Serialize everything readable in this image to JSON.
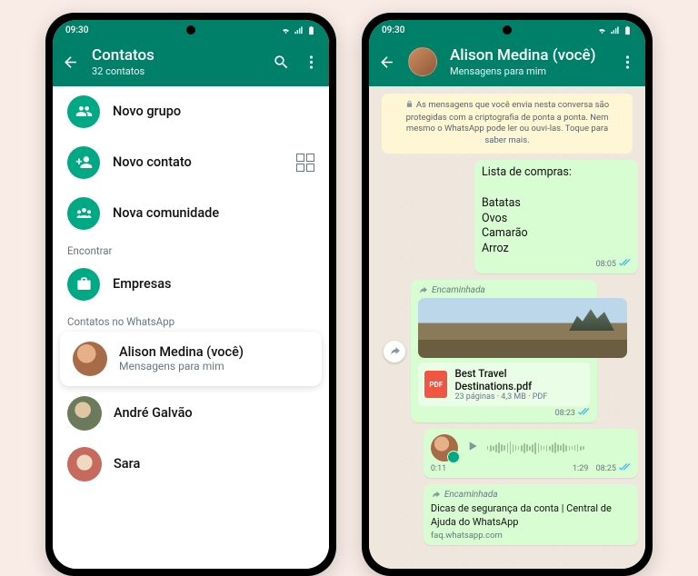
{
  "status": {
    "time": "09:30"
  },
  "left": {
    "header": {
      "title": "Contatos",
      "subtitle": "32 contatos"
    },
    "actions": {
      "new_group": "Novo grupo",
      "new_contact": "Novo contato",
      "new_community": "Nova comunidade"
    },
    "find_label": "Encontrar",
    "businesses": "Empresas",
    "contacts_label": "Contatos no WhatsApp",
    "contacts": [
      {
        "name": "Alison Medina (você)",
        "sub": "Mensagens para mim"
      },
      {
        "name": "André Galvão",
        "sub": ""
      },
      {
        "name": "Sara",
        "sub": ""
      }
    ]
  },
  "right": {
    "header": {
      "title": "Alison Medina (você)",
      "subtitle": "Mensagens para mim"
    },
    "e2e": "As mensagens que você envia nesta conversa são protegidas com a criptografia de ponta a ponta. Nem mesmo o WhatsApp pode ler ou ouvi-las. Toque para saber mais.",
    "msg_list": {
      "text": "Lista de compras:\n\nBatatas\nOvos\nCamarão\nArroz",
      "time": "08:05"
    },
    "forwarded_label": "Encaminhada",
    "pdf": {
      "filename": "Best Travel Destinations.pdf",
      "details": "23 páginas · 4,3 MB · PDF",
      "time": "08:23"
    },
    "voice": {
      "elapsed": "0:11",
      "total": "1:29",
      "time": "08:25"
    },
    "link": {
      "title": "Dicas de segurança da conta | Central de Ajuda do WhatsApp",
      "host": "faq.whatsapp.com"
    }
  }
}
